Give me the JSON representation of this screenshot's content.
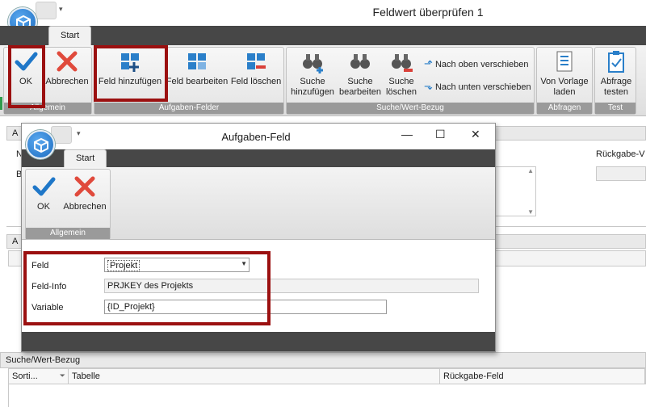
{
  "main_window": {
    "title": "Feldwert überprüfen 1",
    "tab": "Start",
    "groups": {
      "allgemein": "Allgemein",
      "aufgaben_felder": "Aufgaben-Felder",
      "suche_wert_bezug": "Suche/Wert-Bezug",
      "abfragen": "Abfragen",
      "test": "Test"
    },
    "buttons": {
      "ok": "OK",
      "abbrechen": "Abbrechen",
      "feld_hinzufuegen": "Feld hinzufügen",
      "feld_bearbeiten": "Feld bearbeiten",
      "feld_loeschen": "Feld löschen",
      "suche_hinzufuegen_1": "Suche",
      "suche_hinzufuegen_2": "hinzufügen",
      "suche_bearbeiten_1": "Suche",
      "suche_bearbeiten_2": "bearbeiten",
      "suche_loeschen_1": "Suche",
      "suche_loeschen_2": "löschen",
      "nach_oben": "Nach oben verschieben",
      "nach_unten": "Nach unten verschieben",
      "von_vorlage_1": "Von Vorlage",
      "von_vorlage_2": "laden",
      "abfrage_testen_1": "Abfrage",
      "abfrage_testen_2": "testen"
    },
    "background_labels": {
      "n": "N",
      "b": "B",
      "a_header": "A",
      "a_header2": "A",
      "rueckgabe": "Rückgabe-V"
    },
    "suche_panel": {
      "title": "Suche/Wert-Bezug",
      "columns": [
        "Sorti...",
        "Tabelle",
        "Rückgabe-Feld"
      ]
    }
  },
  "dialog": {
    "title": "Aufgaben-Feld",
    "tab": "Start",
    "buttons": {
      "ok": "OK",
      "abbrechen": "Abbrechen"
    },
    "group": "Allgemein",
    "form": {
      "feld_label": "Feld",
      "feld_value": "Projekt",
      "feldinfo_label": "Feld-Info",
      "feldinfo_value": "PRJKEY des Projekts",
      "variable_label": "Variable",
      "variable_value": "{ID_Projekt}"
    }
  },
  "colors": {
    "accent_red": "#9b1010",
    "dark_bar": "#474747",
    "blue": "#1f77c8"
  }
}
